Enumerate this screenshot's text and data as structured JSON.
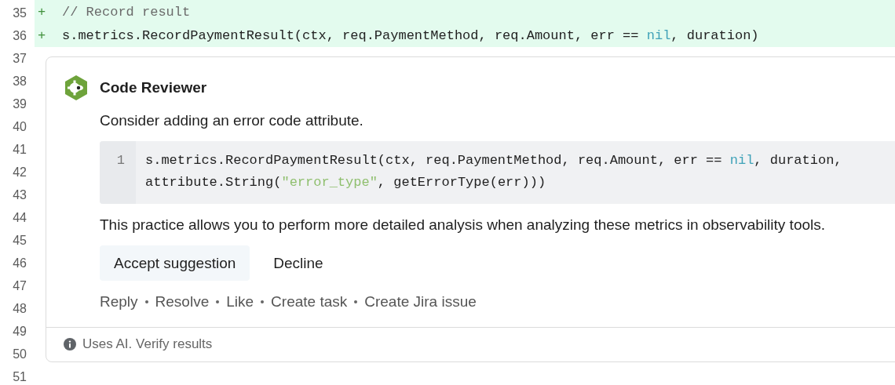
{
  "diff_lines": [
    {
      "number": "35",
      "marker": "+",
      "tokens": [
        {
          "kind": "comment",
          "text": "// Record result"
        }
      ]
    },
    {
      "number": "36",
      "marker": "+",
      "tokens": [
        {
          "kind": "plain",
          "text": "s.metrics.RecordPaymentResult(ctx, req.PaymentMethod, req.Amount, err == "
        },
        {
          "kind": "keyword",
          "text": "nil"
        },
        {
          "kind": "plain",
          "text": ", duration)"
        }
      ]
    }
  ],
  "gutter_numbers": [
    "37",
    "38",
    "39",
    "40",
    "41",
    "42",
    "43",
    "44",
    "45",
    "46",
    "47",
    "48",
    "49",
    "50",
    "51"
  ],
  "comment": {
    "author": "Code Reviewer",
    "message": "Consider adding an error code attribute.",
    "suggestion": {
      "line_number": "1",
      "tokens": [
        {
          "kind": "plain",
          "text": "s.metrics.RecordPaymentResult(ctx, req.PaymentMethod, req.Amount, err == "
        },
        {
          "kind": "keyword",
          "text": "nil"
        },
        {
          "kind": "plain",
          "text": ", duration, attribute.String("
        },
        {
          "kind": "string",
          "text": "\"error_type\""
        },
        {
          "kind": "plain",
          "text": ", getErrorType(err)))"
        }
      ]
    },
    "explanation": "This practice allows you to perform more detailed analysis when analyzing these metrics in observability tools.",
    "buttons": [
      {
        "label": "Accept suggestion",
        "kind": "primary"
      },
      {
        "label": "Decline",
        "kind": "plain"
      }
    ],
    "actions": [
      "Reply",
      "Resolve",
      "Like",
      "Create task",
      "Create Jira issue"
    ],
    "footer": "Uses AI. Verify results"
  }
}
